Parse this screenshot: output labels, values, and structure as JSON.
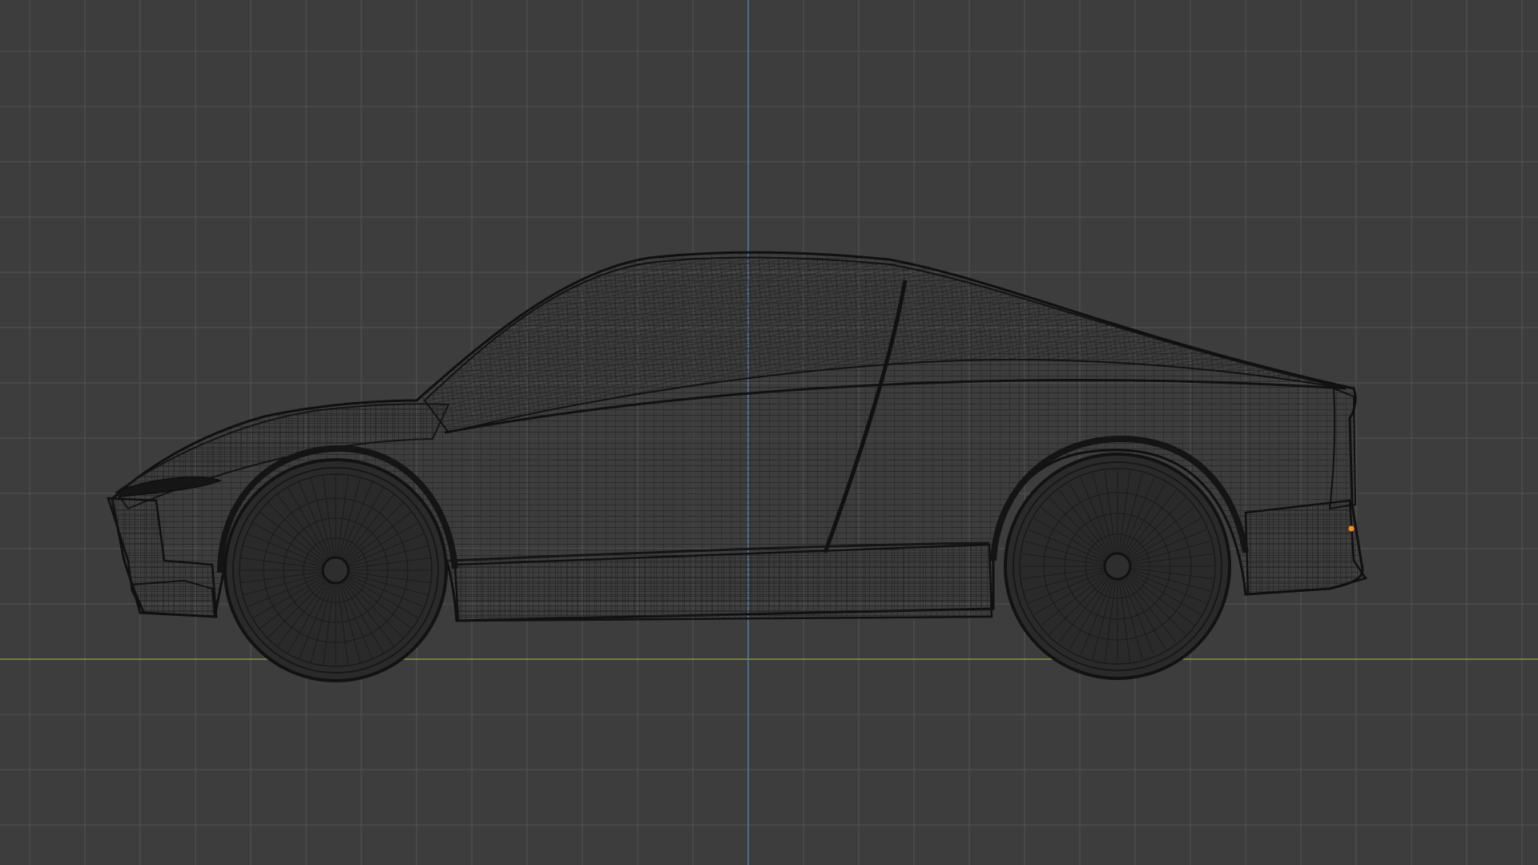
{
  "viewport": {
    "background_color": "#3d3d3d",
    "grid_minor_color": "#474747",
    "grid_major_color": "#525252",
    "axis_x_color": "#7f9a3a",
    "axis_z_color": "#4f7fb0",
    "selected_vertex_color": "#ff8c1a"
  },
  "scene": {
    "object": "car-wireframe-mesh",
    "view": "side",
    "shading": "wireframe"
  }
}
